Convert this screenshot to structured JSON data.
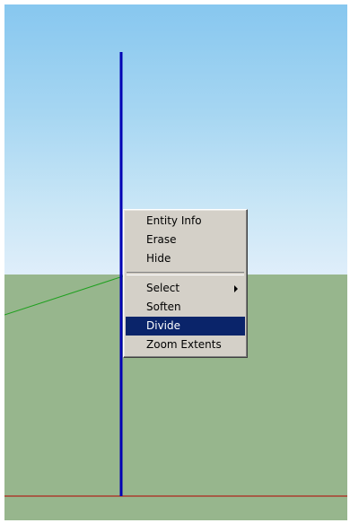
{
  "context_menu": {
    "items": [
      {
        "label": "Entity Info"
      },
      {
        "label": "Erase"
      },
      {
        "label": "Hide"
      },
      {
        "label": "Select",
        "has_submenu": true
      },
      {
        "label": "Soften"
      },
      {
        "label": "Divide",
        "highlighted": true
      },
      {
        "label": "Zoom Extents"
      }
    ],
    "highlight_color": "#0a246a"
  },
  "scene": {
    "sky_color": "#a6d6f2",
    "ground_color": "#97b68d",
    "axis_colors": {
      "blue": "#0000b4",
      "green": "#1ea01e",
      "red": "#b40000"
    }
  }
}
